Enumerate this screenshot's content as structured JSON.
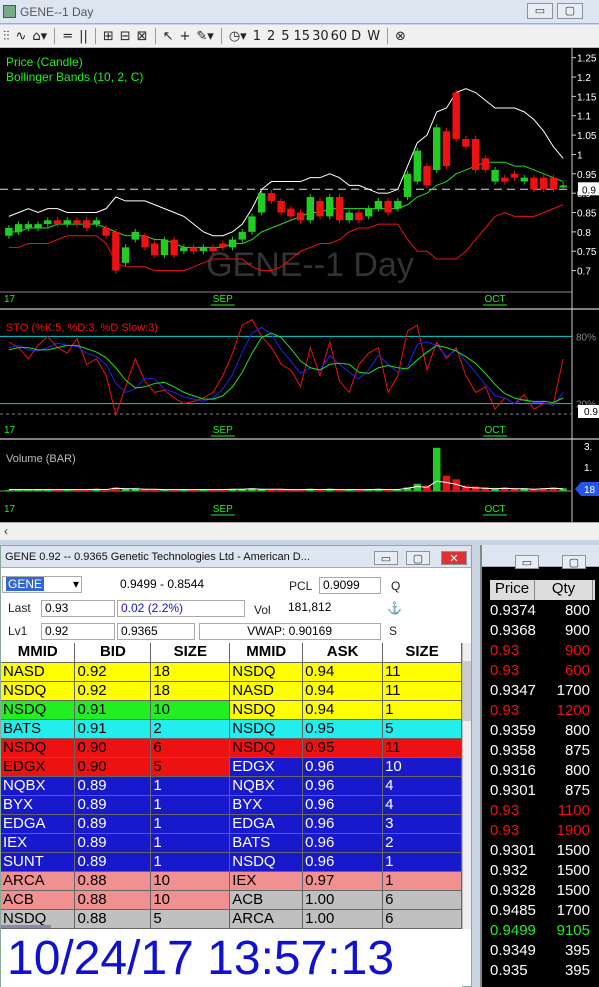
{
  "window": {
    "title": "GENE--1 Day"
  },
  "toolbar": {
    "intervals": [
      "1",
      "2",
      "5",
      "15",
      "30",
      "60",
      "D",
      "W"
    ]
  },
  "chart": {
    "watermark": "GENE--1 Day",
    "price_title": "Price (Candle)",
    "bb_title": "Bollinger Bands (10, 2, C)",
    "sto_title": "STO (%K:5, %D:3, %D Slow:3)",
    "vol_title": "Volume (BAR)",
    "price_axis": [
      "1.25",
      "1.2",
      "1.15",
      "1.1",
      "1.05",
      "1",
      "0.95",
      "0.9",
      "0.85",
      "0.8",
      "0.75",
      "0.7"
    ],
    "price_marker": "0.9",
    "sto_marker": "0.9",
    "vol_marker": "18",
    "sto_levels": [
      "80%",
      "20%"
    ],
    "vol_axis": [
      "3.",
      "1."
    ],
    "x_labels": [
      "17",
      "SEP",
      "OCT"
    ],
    "colors": {
      "up": "#22cc22",
      "down": "#ee1111",
      "bb_upper": "#ffffff",
      "bb_mid": "#22dd22",
      "bb_lower": "#ee1111",
      "sto_k": "#ee1111",
      "sto_d": "#2222ee",
      "sto_slow": "#22dd22",
      "level": "#00d0d0"
    }
  },
  "chart_data": {
    "type": "line",
    "title": "Price (Candle)",
    "candles": [
      {
        "o": 0.79,
        "c": 0.81
      },
      {
        "o": 0.8,
        "c": 0.82
      },
      {
        "o": 0.81,
        "c": 0.82
      },
      {
        "o": 0.81,
        "c": 0.82
      },
      {
        "o": 0.82,
        "c": 0.83
      },
      {
        "o": 0.83,
        "c": 0.82
      },
      {
        "o": 0.82,
        "c": 0.83
      },
      {
        "o": 0.83,
        "c": 0.82
      },
      {
        "o": 0.83,
        "c": 0.81
      },
      {
        "o": 0.82,
        "c": 0.83
      },
      {
        "o": 0.81,
        "c": 0.79
      },
      {
        "o": 0.8,
        "c": 0.7
      },
      {
        "o": 0.72,
        "c": 0.76
      },
      {
        "o": 0.78,
        "c": 0.8
      },
      {
        "o": 0.79,
        "c": 0.76
      },
      {
        "o": 0.77,
        "c": 0.74
      },
      {
        "o": 0.74,
        "c": 0.78
      },
      {
        "o": 0.78,
        "c": 0.74
      },
      {
        "o": 0.75,
        "c": 0.76
      },
      {
        "o": 0.76,
        "c": 0.75
      },
      {
        "o": 0.75,
        "c": 0.76
      },
      {
        "o": 0.76,
        "c": 0.75
      },
      {
        "o": 0.77,
        "c": 0.76
      },
      {
        "o": 0.76,
        "c": 0.78
      },
      {
        "o": 0.78,
        "c": 0.8
      },
      {
        "o": 0.8,
        "c": 0.84
      },
      {
        "o": 0.85,
        "c": 0.9
      },
      {
        "o": 0.9,
        "c": 0.88
      },
      {
        "o": 0.88,
        "c": 0.85
      },
      {
        "o": 0.86,
        "c": 0.84
      },
      {
        "o": 0.85,
        "c": 0.83
      },
      {
        "o": 0.83,
        "c": 0.89
      },
      {
        "o": 0.88,
        "c": 0.84
      },
      {
        "o": 0.84,
        "c": 0.89
      },
      {
        "o": 0.89,
        "c": 0.83
      },
      {
        "o": 0.83,
        "c": 0.85
      },
      {
        "o": 0.85,
        "c": 0.83
      },
      {
        "o": 0.84,
        "c": 0.86
      },
      {
        "o": 0.86,
        "c": 0.88
      },
      {
        "o": 0.88,
        "c": 0.85
      },
      {
        "o": 0.86,
        "c": 0.88
      },
      {
        "o": 0.89,
        "c": 0.95
      },
      {
        "o": 0.93,
        "c": 1.01
      },
      {
        "o": 0.97,
        "c": 0.92
      },
      {
        "o": 0.96,
        "c": 1.07
      },
      {
        "o": 1.06,
        "c": 0.97
      },
      {
        "o": 1.16,
        "c": 1.04
      },
      {
        "o": 1.04,
        "c": 1.02
      },
      {
        "o": 1.04,
        "c": 0.96
      },
      {
        "o": 0.99,
        "c": 0.96
      },
      {
        "o": 0.93,
        "c": 0.96
      },
      {
        "o": 0.94,
        "c": 0.93
      },
      {
        "o": 0.95,
        "c": 0.94
      },
      {
        "o": 0.93,
        "c": 0.94
      },
      {
        "o": 0.94,
        "c": 0.91
      },
      {
        "o": 0.94,
        "c": 0.91
      },
      {
        "o": 0.94,
        "c": 0.91
      },
      {
        "o": 0.92,
        "c": 0.92
      }
    ],
    "bb_upper": [
      0.84,
      0.85,
      0.86,
      0.85,
      0.86,
      0.86,
      0.85,
      0.85,
      0.85,
      0.85,
      0.86,
      0.89,
      0.88,
      0.88,
      0.88,
      0.87,
      0.86,
      0.85,
      0.84,
      0.82,
      0.8,
      0.79,
      0.79,
      0.8,
      0.82,
      0.86,
      0.91,
      0.93,
      0.93,
      0.93,
      0.93,
      0.94,
      0.94,
      0.95,
      0.94,
      0.92,
      0.92,
      0.91,
      0.9,
      0.9,
      0.91,
      0.97,
      1.03,
      1.05,
      1.11,
      1.12,
      1.16,
      1.17,
      1.16,
      1.14,
      1.12,
      1.12,
      1.12,
      1.11,
      1.09,
      1.06,
      1.02,
      0.99
    ],
    "bb_mid": [
      0.8,
      0.8,
      0.81,
      0.81,
      0.81,
      0.82,
      0.82,
      0.82,
      0.82,
      0.82,
      0.81,
      0.8,
      0.79,
      0.79,
      0.79,
      0.78,
      0.78,
      0.77,
      0.76,
      0.76,
      0.76,
      0.76,
      0.76,
      0.77,
      0.77,
      0.78,
      0.8,
      0.81,
      0.82,
      0.83,
      0.84,
      0.85,
      0.85,
      0.86,
      0.86,
      0.86,
      0.86,
      0.86,
      0.86,
      0.86,
      0.86,
      0.87,
      0.89,
      0.9,
      0.92,
      0.93,
      0.95,
      0.96,
      0.97,
      0.98,
      0.98,
      0.98,
      0.97,
      0.97,
      0.96,
      0.95,
      0.94,
      0.93
    ],
    "bb_lower": [
      0.76,
      0.76,
      0.77,
      0.77,
      0.77,
      0.78,
      0.79,
      0.79,
      0.79,
      0.79,
      0.77,
      0.72,
      0.71,
      0.71,
      0.71,
      0.7,
      0.7,
      0.7,
      0.7,
      0.71,
      0.72,
      0.73,
      0.73,
      0.73,
      0.73,
      0.71,
      0.7,
      0.7,
      0.71,
      0.73,
      0.75,
      0.76,
      0.77,
      0.77,
      0.78,
      0.8,
      0.81,
      0.81,
      0.82,
      0.82,
      0.82,
      0.78,
      0.75,
      0.75,
      0.73,
      0.73,
      0.73,
      0.75,
      0.78,
      0.81,
      0.84,
      0.85,
      0.84,
      0.84,
      0.84,
      0.85,
      0.86,
      0.87
    ],
    "sto_k": [
      75,
      70,
      60,
      72,
      80,
      70,
      65,
      78,
      55,
      60,
      45,
      10,
      35,
      60,
      40,
      30,
      32,
      25,
      20,
      22,
      25,
      30,
      45,
      65,
      90,
      95,
      80,
      70,
      55,
      50,
      35,
      70,
      45,
      75,
      40,
      30,
      55,
      65,
      70,
      30,
      45,
      85,
      90,
      50,
      75,
      60,
      70,
      45,
      30,
      35,
      15,
      25,
      20,
      28,
      15,
      20,
      20,
      60
    ],
    "sto_d": [
      70,
      72,
      68,
      67,
      70,
      74,
      72,
      71,
      65,
      62,
      55,
      38,
      30,
      33,
      43,
      42,
      33,
      30,
      26,
      24,
      22,
      25,
      33,
      46,
      66,
      83,
      88,
      82,
      68,
      58,
      47,
      52,
      50,
      63,
      55,
      48,
      42,
      50,
      63,
      55,
      48,
      53,
      73,
      75,
      72,
      62,
      68,
      58,
      48,
      37,
      27,
      25,
      20,
      24,
      21,
      21,
      18,
      30
    ],
    "sto_slow": [
      68,
      70,
      70,
      68,
      68,
      70,
      72,
      72,
      69,
      66,
      61,
      52,
      41,
      34,
      35,
      38,
      39,
      35,
      30,
      27,
      24,
      24,
      27,
      35,
      48,
      65,
      79,
      83,
      79,
      69,
      58,
      52,
      50,
      55,
      56,
      55,
      48,
      47,
      52,
      54,
      52,
      51,
      59,
      66,
      72,
      70,
      67,
      62,
      56,
      47,
      37,
      29,
      25,
      23,
      22,
      22,
      21,
      25
    ],
    "volume": [
      1,
      1,
      1,
      1,
      1,
      1,
      1,
      1,
      1,
      2,
      1,
      4,
      3,
      3,
      2,
      2,
      1,
      1,
      1,
      1,
      1,
      1,
      1,
      2,
      2,
      3,
      2,
      2,
      2,
      1,
      1,
      2,
      1,
      2,
      1,
      1,
      1,
      1,
      2,
      1,
      1,
      4,
      8,
      6,
      48,
      17,
      13,
      6,
      5,
      4,
      3,
      4,
      3,
      3,
      2,
      3,
      4,
      3
    ],
    "xlabels_at": {
      "SEP": 22,
      "OCT": 50
    }
  },
  "l2": {
    "title": "GENE   0.92 -- 0.9365   Genetic Technologies Ltd - American D...",
    "symbol": "GENE",
    "range": "0.9499 - 0.8544",
    "pcl_label": "PCL",
    "pcl": "0.9099",
    "q": "Q",
    "last_label": "Last",
    "last": "0.93",
    "change": "0.02  (2.2%)",
    "vol_label": "Vol",
    "vol": "181,812",
    "lv1_label": "Lv1",
    "lv1_bid": "0.92",
    "lv1_ask": "0.9365",
    "vwap": "VWAP: 0.90169",
    "s": "S",
    "headers": [
      "MMID",
      "BID",
      "SIZE",
      "MMID",
      "ASK",
      "SIZE"
    ],
    "rows": [
      {
        "bm": "NASD",
        "bp": "0.92",
        "bs": "18",
        "bc": "#ffff00",
        "am": "NSDQ",
        "ap": "0.94",
        "as": "11",
        "ac": "#ffff00"
      },
      {
        "bm": "NSDQ",
        "bp": "0.92",
        "bs": "18",
        "bc": "#ffff00",
        "am": "NASD",
        "ap": "0.94",
        "as": "11",
        "ac": "#ffff00"
      },
      {
        "bm": "NSDQ",
        "bp": "0.91",
        "bs": "10",
        "bc": "#22ee22",
        "am": "NSDQ",
        "ap": "0.94",
        "as": "1",
        "ac": "#ffff00"
      },
      {
        "bm": "BATS",
        "bp": "0.91",
        "bs": "2",
        "bc": "#22eeee",
        "am": "NSDQ",
        "ap": "0.95",
        "as": "5",
        "ac": "#22eeee"
      },
      {
        "bm": "NSDQ",
        "bp": "0.90",
        "bs": "6",
        "bc": "#ee1111",
        "am": "NSDQ",
        "ap": "0.95",
        "as": "11",
        "ac": "#ee1111"
      },
      {
        "bm": "EDGX",
        "bp": "0.90",
        "bs": "5",
        "bc": "#ee1111",
        "am": "EDGX",
        "ap": "0.96",
        "as": "10",
        "ac": "#1818cc"
      },
      {
        "bm": "NQBX",
        "bp": "0.89",
        "bs": "1",
        "bc": "#1818cc",
        "am": "NQBX",
        "ap": "0.96",
        "as": "4",
        "ac": "#1818cc"
      },
      {
        "bm": "BYX",
        "bp": "0.89",
        "bs": "1",
        "bc": "#1818cc",
        "am": "BYX",
        "ap": "0.96",
        "as": "4",
        "ac": "#1818cc"
      },
      {
        "bm": "EDGA",
        "bp": "0.89",
        "bs": "1",
        "bc": "#1818cc",
        "am": "EDGA",
        "ap": "0.96",
        "as": "3",
        "ac": "#1818cc"
      },
      {
        "bm": "IEX",
        "bp": "0.89",
        "bs": "1",
        "bc": "#1818cc",
        "am": "BATS",
        "ap": "0.96",
        "as": "2",
        "ac": "#1818cc"
      },
      {
        "bm": "SUNT",
        "bp": "0.89",
        "bs": "1",
        "bc": "#1818cc",
        "am": "NSDQ",
        "ap": "0.96",
        "as": "1",
        "ac": "#1818cc"
      },
      {
        "bm": "ARCA",
        "bp": "0.88",
        "bs": "10",
        "bc": "#f09090",
        "am": "IEX",
        "ap": "0.97",
        "as": "1",
        "ac": "#f09090"
      },
      {
        "bm": "ACB",
        "bp": "0.88",
        "bs": "10",
        "bc": "#f09090",
        "am": "ACB",
        "ap": "1.00",
        "as": "6",
        "ac": "#c0c0c0"
      },
      {
        "bm": "NSDQ",
        "bp": "0.88",
        "bs": "5",
        "bc": "#c0c0c0",
        "am": "ARCA",
        "ap": "1.00",
        "as": "6",
        "ac": "#c0c0c0"
      }
    ],
    "clock": "10/24/17 13:57:13"
  },
  "ts": {
    "headers": [
      "Price",
      "Qty"
    ],
    "rows": [
      {
        "p": "0.9374",
        "q": "800",
        "c": "#ffffff"
      },
      {
        "p": "0.9368",
        "q": "900",
        "c": "#ffffff"
      },
      {
        "p": "0.93",
        "q": "900",
        "c": "#ee1111"
      },
      {
        "p": "0.93",
        "q": "600",
        "c": "#ee1111"
      },
      {
        "p": "0.9347",
        "q": "1700",
        "c": "#ffffff"
      },
      {
        "p": "0.93",
        "q": "1200",
        "c": "#ee1111"
      },
      {
        "p": "0.9359",
        "q": "800",
        "c": "#ffffff"
      },
      {
        "p": "0.9358",
        "q": "875",
        "c": "#ffffff"
      },
      {
        "p": "0.9316",
        "q": "800",
        "c": "#ffffff"
      },
      {
        "p": "0.9301",
        "q": "875",
        "c": "#ffffff"
      },
      {
        "p": "0.93",
        "q": "1100",
        "c": "#ee1111"
      },
      {
        "p": "0.93",
        "q": "1900",
        "c": "#ee1111"
      },
      {
        "p": "0.9301",
        "q": "1500",
        "c": "#ffffff"
      },
      {
        "p": "0.932",
        "q": "1500",
        "c": "#ffffff"
      },
      {
        "p": "0.9328",
        "q": "1500",
        "c": "#ffffff"
      },
      {
        "p": "0.9485",
        "q": "1700",
        "c": "#ffffff"
      },
      {
        "p": "0.9499",
        "q": "9105",
        "c": "#22ee22"
      },
      {
        "p": "0.9349",
        "q": "395",
        "c": "#ffffff"
      },
      {
        "p": "0.935",
        "q": "395",
        "c": "#ffffff"
      }
    ]
  }
}
